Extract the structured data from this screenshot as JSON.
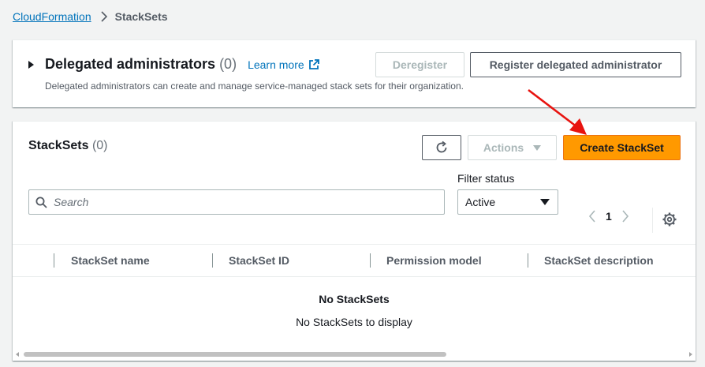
{
  "breadcrumb": {
    "root": "CloudFormation",
    "current": "StackSets"
  },
  "delegated": {
    "title": "Delegated administrators",
    "count": "(0)",
    "learn_more": "Learn more",
    "description": "Delegated administrators can create and manage service-managed stack sets for their organization.",
    "deregister_label": "Deregister",
    "register_label": "Register delegated administrator"
  },
  "stacksets": {
    "title": "StackSets",
    "count": "(0)",
    "actions_label": "Actions",
    "create_label": "Create StackSet",
    "filter_status_label": "Filter status",
    "filter_status_value": "Active",
    "search_placeholder": "Search",
    "page_number": "1",
    "columns": [
      "StackSet name",
      "StackSet ID",
      "Permission model",
      "StackSet description"
    ],
    "empty_title": "No StackSets",
    "empty_message": "No StackSets to display"
  },
  "icons": {
    "breadcrumb_separator": "chevron-right-icon",
    "expand": "caret-right-icon",
    "external_link": "external-link-icon",
    "refresh": "refresh-icon",
    "actions_dropdown": "caret-down-icon",
    "search": "search-icon",
    "select_dropdown": "caret-down-icon",
    "prev_page": "chevron-left-icon",
    "next_page": "chevron-right-icon",
    "settings": "gear-icon",
    "annotation": "red-arrow-icon"
  },
  "colors": {
    "primary_button": "#ff9900",
    "link": "#0073bb",
    "annotation_arrow": "#e8130f",
    "background": "#f2f3f3"
  }
}
